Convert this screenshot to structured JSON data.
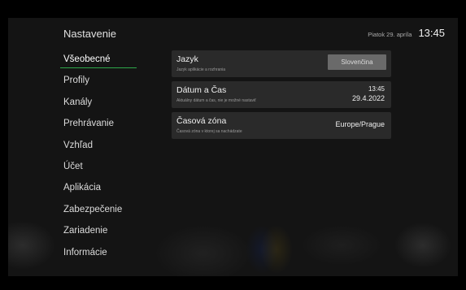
{
  "header": {
    "title": "Nastavenie",
    "date": "Piatok 29. apríla",
    "time": "13:45"
  },
  "sidebar": {
    "items": [
      {
        "label": "Všeobecné",
        "active": true
      },
      {
        "label": "Profily"
      },
      {
        "label": "Kanály"
      },
      {
        "label": "Prehrávanie"
      },
      {
        "label": "Vzhľad"
      },
      {
        "label": "Účet"
      },
      {
        "label": "Aplikácia"
      },
      {
        "label": "Zabezpečenie"
      },
      {
        "label": "Zariadenie"
      },
      {
        "label": "Informácie"
      }
    ]
  },
  "settings": {
    "language": {
      "title": "Jazyk",
      "subtitle": "Jazyk aplikácie a rozhrania",
      "value": "Slovenčina"
    },
    "datetime": {
      "title": "Dátum a Čas",
      "subtitle": "Aktuálny dátum a čas, nie je možné nastaviť",
      "time": "13:45",
      "date": "29.4.2022"
    },
    "timezone": {
      "title": "Časová zóna",
      "subtitle": "Časová zóna v ktorej sa nachádzate",
      "value": "Europe/Prague"
    }
  },
  "colors": {
    "accent": "#2ea84a",
    "row_bg": "#2a2a2a",
    "button_bg": "#6a6a6a"
  }
}
